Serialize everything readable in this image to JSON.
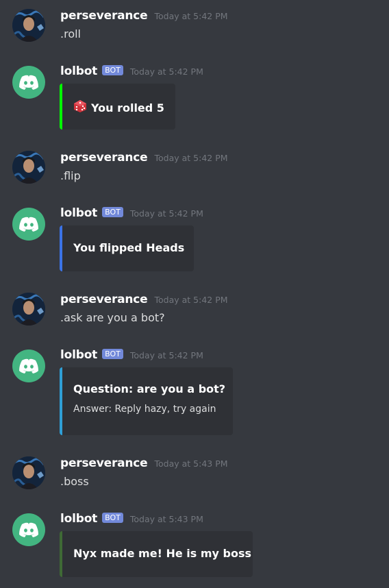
{
  "colors": {
    "background": "#36393f",
    "embed_background": "#2f3136",
    "bot_tag": "#7289da",
    "bot_avatar": "#43b581",
    "embed_green": "#00ff00",
    "embed_blue": "#3b73e6",
    "embed_cyan": "#2f9fd6",
    "embed_darkgreen": "#3f6a35"
  },
  "messages": [
    {
      "user": "perseverance",
      "timestamp": "Today at 5:42 PM",
      "text": ".roll"
    },
    {
      "user": "lolbot",
      "tag": "BOT",
      "timestamp": "Today at 5:42 PM",
      "embed": {
        "title": "You rolled 5",
        "icon": "dice-icon",
        "color": "#00ff00"
      }
    },
    {
      "user": "perseverance",
      "timestamp": "Today at 5:42 PM",
      "text": ".flip"
    },
    {
      "user": "lolbot",
      "tag": "BOT",
      "timestamp": "Today at 5:42 PM",
      "embed": {
        "title": "You flipped Heads",
        "color": "#3b73e6"
      }
    },
    {
      "user": "perseverance",
      "timestamp": "Today at 5:42 PM",
      "text": ".ask are you a bot?"
    },
    {
      "user": "lolbot",
      "tag": "BOT",
      "timestamp": "Today at 5:42 PM",
      "embed": {
        "title": "Question: are you a bot?",
        "description": "Answer: Reply hazy, try again",
        "color": "#2f9fd6"
      }
    },
    {
      "user": "perseverance",
      "timestamp": "Today at 5:43 PM",
      "text": ".boss"
    },
    {
      "user": "lolbot",
      "tag": "BOT",
      "timestamp": "Today at 5:43 PM",
      "embed": {
        "title": "Nyx made me! He is my boss",
        "color": "#3f6a35"
      }
    }
  ]
}
